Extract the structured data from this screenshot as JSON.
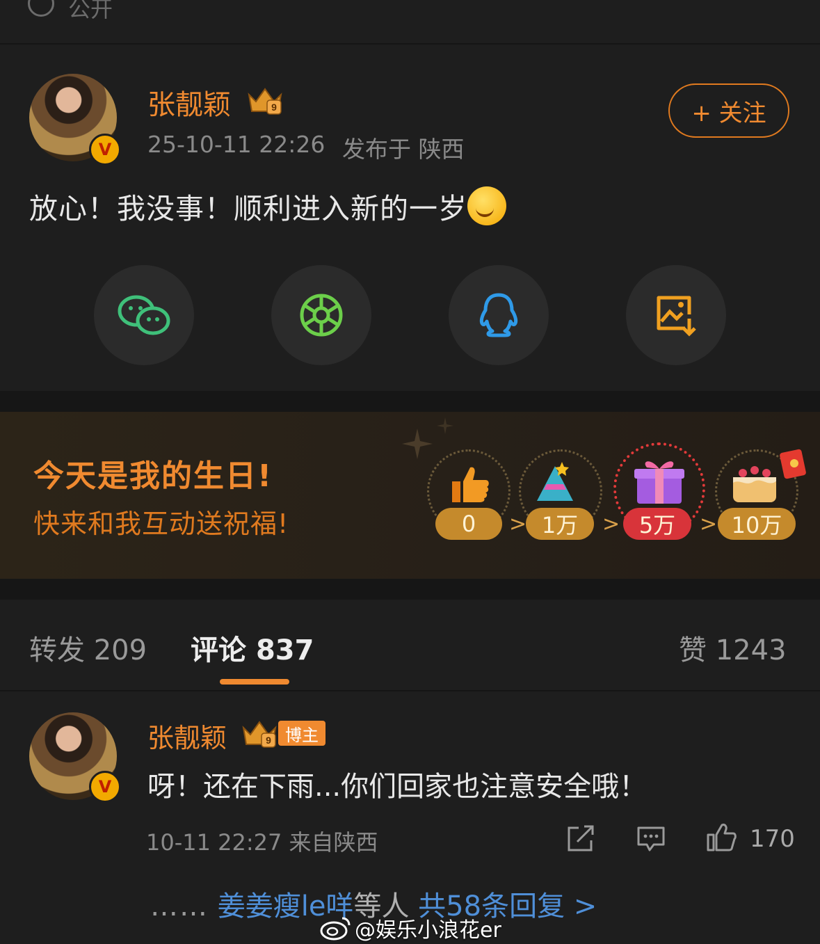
{
  "top": {
    "visibility_label": "公开",
    "icon": "globe-icon"
  },
  "post": {
    "author": "张靓颖",
    "level": "9",
    "timestamp": "25-10-11 22:26",
    "location": "发布于 陕西",
    "follow_label": "+ 关注",
    "text": "放心！我没事！顺利进入新的一岁",
    "emoji": "wink-face-emoji"
  },
  "share": {
    "items": [
      {
        "name": "wechat",
        "icon": "wechat-icon",
        "color": "#3fc07a"
      },
      {
        "name": "moments",
        "icon": "moments-icon",
        "color": "#6ccf4a"
      },
      {
        "name": "qq",
        "icon": "qq-icon",
        "color": "#2f9ae8"
      },
      {
        "name": "save-image",
        "icon": "save-image-icon",
        "color": "#f0a020"
      }
    ]
  },
  "birthday": {
    "title": "今天是我的生日!",
    "subtitle": "快来和我互动送祝福!",
    "milestones": [
      {
        "label": "0",
        "icon": "thumbs-up-icon"
      },
      {
        "label": "1万",
        "icon": "party-hat-icon"
      },
      {
        "label": "5万",
        "icon": "gift-box-icon"
      },
      {
        "label": "10万",
        "icon": "cake-icon"
      }
    ],
    "arrow": ">"
  },
  "tabs": {
    "repost": {
      "label": "转发",
      "count": "209"
    },
    "comment": {
      "label": "评论",
      "count": "837"
    },
    "like": {
      "label": "赞",
      "count": "1243"
    }
  },
  "comment": {
    "author": "张靓颖",
    "level": "9",
    "badge": "博主",
    "text": "呀！还在下雨...你们回家也注意安全哦！",
    "meta": "10-11 22:27 来自陕西",
    "like_count": "170",
    "reply": {
      "dots": "……",
      "users": "姜姜瘦le咩",
      "etc": "等人",
      "total": "共58条回复 >"
    }
  },
  "watermark": "@娱乐小浪花er",
  "colors": {
    "accent": "#f08a30",
    "link": "#4f8fd8",
    "background": "#1e1e1e"
  }
}
